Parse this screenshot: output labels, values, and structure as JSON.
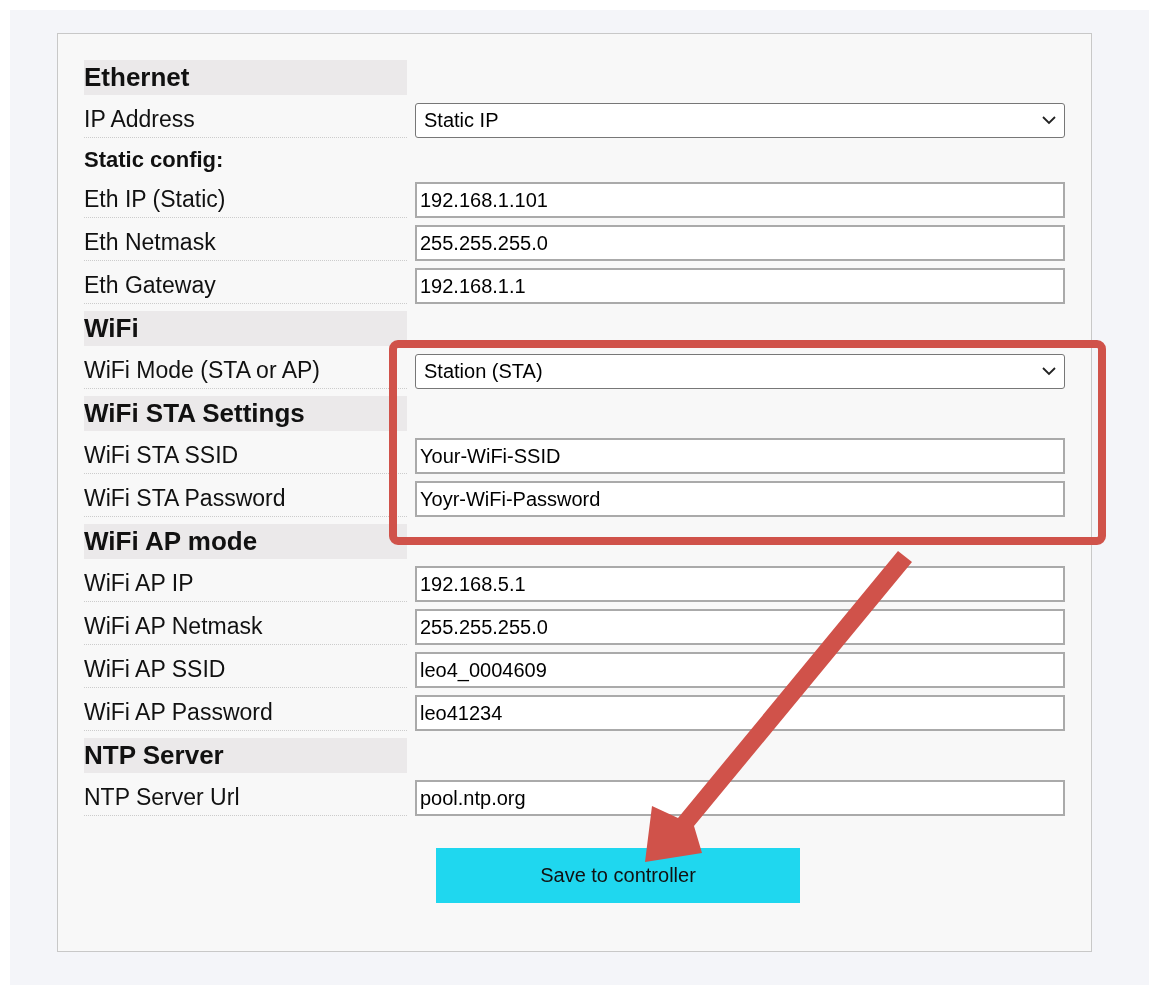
{
  "form": {
    "rows": [
      {
        "kind": "header",
        "label": "Ethernet"
      },
      {
        "kind": "select",
        "label": "IP Address",
        "value": "Static IP"
      },
      {
        "kind": "subheader",
        "label": "Static config:"
      },
      {
        "kind": "text",
        "label": "Eth IP (Static)",
        "value": "192.168.1.101"
      },
      {
        "kind": "text",
        "label": "Eth Netmask",
        "value": "255.255.255.0"
      },
      {
        "kind": "text",
        "label": "Eth Gateway",
        "value": "192.168.1.1"
      },
      {
        "kind": "header",
        "label": "WiFi"
      },
      {
        "kind": "select",
        "label": "WiFi Mode (STA or AP)",
        "value": "Station (STA)"
      },
      {
        "kind": "header",
        "label": "WiFi STA Settings"
      },
      {
        "kind": "text",
        "label": "WiFi STA SSID",
        "value": "Your-WiFi-SSID"
      },
      {
        "kind": "text",
        "label": "WiFi STA Password",
        "value": "Yoyr-WiFi-Password"
      },
      {
        "kind": "header",
        "label": "WiFi AP mode"
      },
      {
        "kind": "text",
        "label": "WiFi AP IP",
        "value": "192.168.5.1"
      },
      {
        "kind": "text",
        "label": "WiFi AP Netmask",
        "value": "255.255.255.0"
      },
      {
        "kind": "text",
        "label": "WiFi AP SSID",
        "value": "leo4_0004609"
      },
      {
        "kind": "text",
        "label": "WiFi AP Password",
        "value": "leo41234"
      },
      {
        "kind": "header",
        "label": "NTP Server"
      },
      {
        "kind": "text",
        "label": "NTP Server Url",
        "value": "pool.ntp.org"
      }
    ],
    "save_button": "Save to controller"
  },
  "annotations": {
    "highlight_box": {
      "color": "#d0524a"
    },
    "arrow": {
      "color": "#d0524a"
    }
  }
}
